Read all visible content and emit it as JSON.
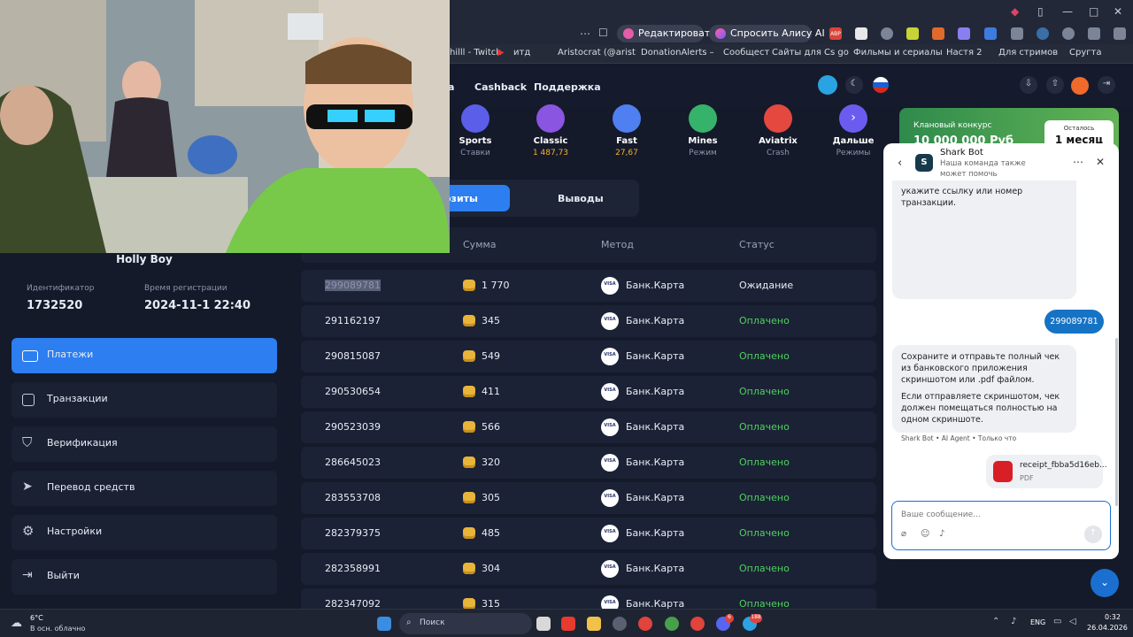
{
  "browser": {
    "edit_label": "Редактировать",
    "alice_label": "Спросить Алису AI",
    "window_controls": [
      "—",
      "□",
      "✕"
    ],
    "bookmarks": [
      "hilll - Twitch",
      "итд",
      "Aristocrat (@arist",
      "DonationAlerts – ",
      "Сообщест",
      "Сайты для Cs go",
      "Фильмы и сериалы",
      "Настя 2",
      "Для стримов",
      "Сругта"
    ]
  },
  "site_nav": {
    "items": [
      "a",
      "Cashback",
      "Поддержка"
    ]
  },
  "games": [
    {
      "title": "Sports",
      "sub": "Ставки",
      "color": "#5a5ee8",
      "sub_color": "#8d95aa",
      "icon": "sports-icon"
    },
    {
      "title": "Classic",
      "sub": "1 487,73",
      "color": "#8a55e0",
      "sub_color": "#f2b035",
      "icon": "swords-icon"
    },
    {
      "title": "Fast",
      "sub": "27,67",
      "color": "#4f7ff0",
      "sub_color": "#f2b035",
      "icon": "crown-icon"
    },
    {
      "title": "Mines",
      "sub": "Режим",
      "color": "#36b36a",
      "sub_color": "#8d95aa",
      "icon": "mine-icon"
    },
    {
      "title": "Aviatrix",
      "sub": "Crash",
      "color": "#e4483f",
      "sub_color": "#8d95aa",
      "icon": "plane-icon"
    },
    {
      "title": "Дальше",
      "sub": "Режимы",
      "color": "#6b5cf0",
      "sub_color": "#8d95aa",
      "icon": "chevron-right-icon"
    }
  ],
  "tabs": {
    "deposits": "озиты",
    "withdrawals": "Выводы"
  },
  "table": {
    "headers": [
      "Сумма",
      "Метод",
      "Статус"
    ],
    "rows": [
      {
        "id": "299089781",
        "amount": "1 770",
        "method": "Банк.Карта",
        "status": "Ожидание",
        "status_color": "#e8ecf5"
      },
      {
        "id": "291162197",
        "amount": "345",
        "method": "Банк.Карта",
        "status": "Оплачено",
        "status_color": "#4fd15f"
      },
      {
        "id": "290815087",
        "amount": "549",
        "method": "Банк.Карта",
        "status": "Оплачено",
        "status_color": "#4fd15f"
      },
      {
        "id": "290530654",
        "amount": "411",
        "method": "Банк.Карта",
        "status": "Оплачено",
        "status_color": "#4fd15f"
      },
      {
        "id": "290523039",
        "amount": "566",
        "method": "Банк.Карта",
        "status": "Оплачено",
        "status_color": "#4fd15f"
      },
      {
        "id": "286645023",
        "amount": "320",
        "method": "Банк.Карта",
        "status": "Оплачено",
        "status_color": "#4fd15f"
      },
      {
        "id": "283553708",
        "amount": "305",
        "method": "Банк.Карта",
        "status": "Оплачено",
        "status_color": "#4fd15f"
      },
      {
        "id": "282379375",
        "amount": "485",
        "method": "Банк.Карта",
        "status": "Оплачено",
        "status_color": "#4fd15f"
      },
      {
        "id": "282358991",
        "amount": "304",
        "method": "Банк.Карта",
        "status": "Оплачено",
        "status_color": "#4fd15f"
      },
      {
        "id": "282347092",
        "amount": "315",
        "method": "Банк.Карта",
        "status": "Оплачено",
        "status_color": "#4fd15f"
      }
    ]
  },
  "profile": {
    "name": "Holly Boy",
    "id_label": "Идентификатор",
    "id_value": "1732520",
    "reg_label": "Время регистрации",
    "reg_value": "2024-11-1 22:40"
  },
  "menu": [
    {
      "label": "Платежи",
      "icon": "card-icon",
      "active": true
    },
    {
      "label": "Транзакции",
      "icon": "calendar-icon",
      "active": false
    },
    {
      "label": "Верификация",
      "icon": "shield-icon",
      "active": false
    },
    {
      "label": "Перевод средств",
      "icon": "send-icon",
      "active": false
    },
    {
      "label": "Настройки",
      "icon": "gear-icon",
      "active": false
    },
    {
      "label": "Выйти",
      "icon": "logout-icon",
      "active": false
    }
  ],
  "promo": {
    "title": "Клановый конкурс",
    "amount": "10 000 000 Руб",
    "left_label": "Осталось",
    "left_value": "1 месяц"
  },
  "chat": {
    "avatar_letter": "S",
    "title": "Shark Bot",
    "subtitle": "Наша команда также может помочь",
    "prompt_text": "укажите ссылку или номер транзакции.",
    "user_message": "299089781",
    "bot_message_1": "Сохраните и отправьте полный чек из банковского приложения скриншотом или .pdf файлом.",
    "bot_message_2": "Если отправляете скриншотом, чек должен помещаться полностью на одном скриншоте.",
    "bot_meta": "Shark Bot • AI Agent • Только что",
    "file_name": "receipt_fbba5d16eb...",
    "file_type": "PDF",
    "input_placeholder": "Ваше сообщение..."
  },
  "taskbar": {
    "weather_temp": "6°C",
    "weather_desc": "В осн. облачно",
    "search_label": "Поиск",
    "lang": "ENG",
    "time": "0:32",
    "date": "26.04.2026",
    "badge_discord": "6",
    "badge_telegram": "188"
  }
}
